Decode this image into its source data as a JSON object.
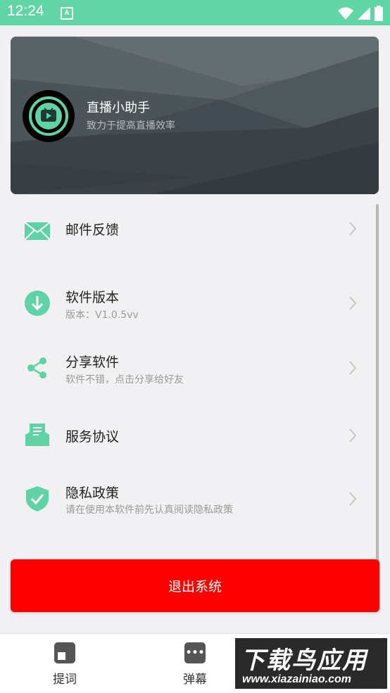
{
  "status_bar": {
    "time": "12:24",
    "notification_badge": "A",
    "icons": [
      "wifi-icon",
      "signal-icon",
      "battery-icon"
    ]
  },
  "header": {
    "title": "直播小助手",
    "subtitle": "致力于提高直播效率"
  },
  "menu": {
    "items": [
      {
        "label": "邮件反馈",
        "sub": "",
        "icon": "mail-icon"
      },
      {
        "label": "软件版本",
        "sub": "版本：V1.0.5vv",
        "icon": "download-icon"
      },
      {
        "label": "分享软件",
        "sub": "软件不错，点击分享给好友",
        "icon": "share-icon"
      },
      {
        "label": "服务协议",
        "sub": "",
        "icon": "agreement-icon"
      },
      {
        "label": "隐私政策",
        "sub": "请在使用本软件前先认真阅读隐私政策",
        "icon": "shield-check-icon"
      }
    ]
  },
  "logout_label": "退出系统",
  "bottom_nav": {
    "items": [
      {
        "label": "提词",
        "icon": "teleprompter-icon"
      },
      {
        "label": "弹幕",
        "icon": "danmaku-icon"
      }
    ]
  },
  "watermark": {
    "title": "下载鸟应用",
    "url": "www.xiazainiao.com"
  },
  "colors": {
    "status_bar": "#62d5a7",
    "accent_green": "#5fd3a5",
    "logout_red": "#ff0000",
    "header_bg": "#3d464c"
  }
}
